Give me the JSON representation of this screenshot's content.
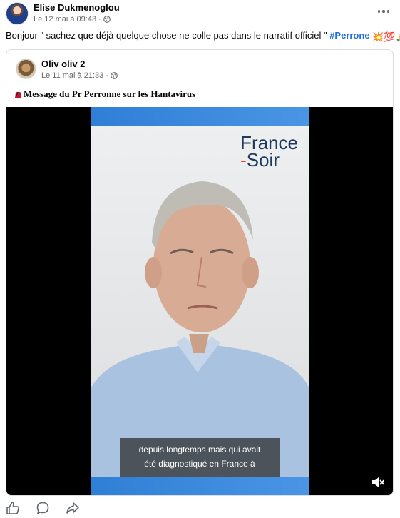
{
  "post": {
    "author": "Elise Dukmenoglou",
    "timestamp": "Le 12 mai à 09:43",
    "text": "Bonjour \" sachez que déjà quelque chose ne colle pas dans le narratif officiel \"",
    "hashtag": "#Perrone",
    "emojis": [
      "💥",
      "💯",
      "🙏"
    ]
  },
  "shared_post": {
    "author": "Oliv oliv 2",
    "timestamp": "Le 11 mai à 21:33",
    "title": "Message du Pr Perronne sur les Hantavirus"
  },
  "video": {
    "brand_line1": "France",
    "brand_dash": "-",
    "brand_line2": "Soir",
    "subtitle_line1": "depuis longtemps mais qui avait",
    "subtitle_line2": "été diagnostiqué en France à",
    "muted": true
  },
  "icons": [
    "globe-icon",
    "more-options-icon",
    "fez-emoji-icon",
    "mute-icon",
    "like-icon",
    "comment-icon",
    "share-icon"
  ],
  "colors": {
    "hashtag": "#216fdb",
    "meta": "#65676b",
    "video_bar": "#2f7fd6",
    "brand_text": "#1e3b5c",
    "brand_accent": "#e33b33"
  }
}
